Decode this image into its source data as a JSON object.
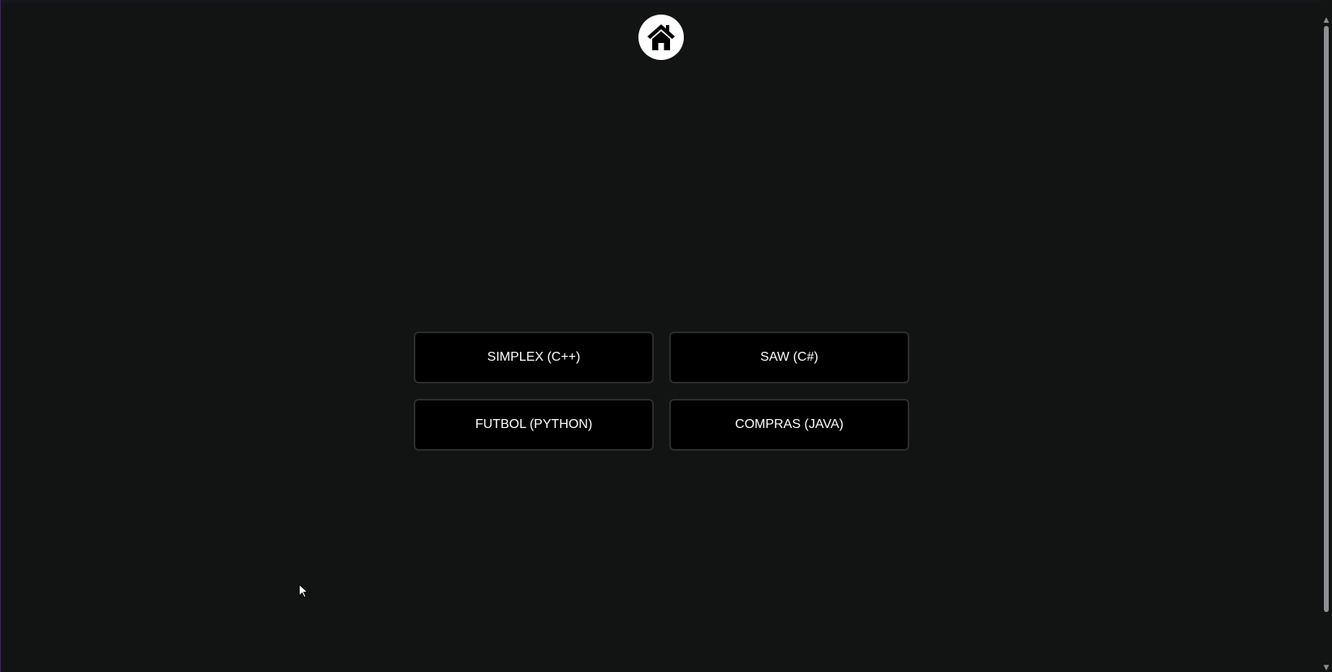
{
  "header": {
    "home_icon": "home-icon"
  },
  "menu": {
    "buttons": [
      {
        "label": "SIMPLEX (C++)"
      },
      {
        "label": "SAW (C#)"
      },
      {
        "label": "FUTBOL (PYTHON)"
      },
      {
        "label": "COMPRAS (JAVA)"
      }
    ]
  },
  "colors": {
    "background": "#121413",
    "button_bg": "#000000",
    "button_border": "#2c2e2d",
    "button_text": "#ffffff",
    "home_circle": "#ffffff"
  }
}
